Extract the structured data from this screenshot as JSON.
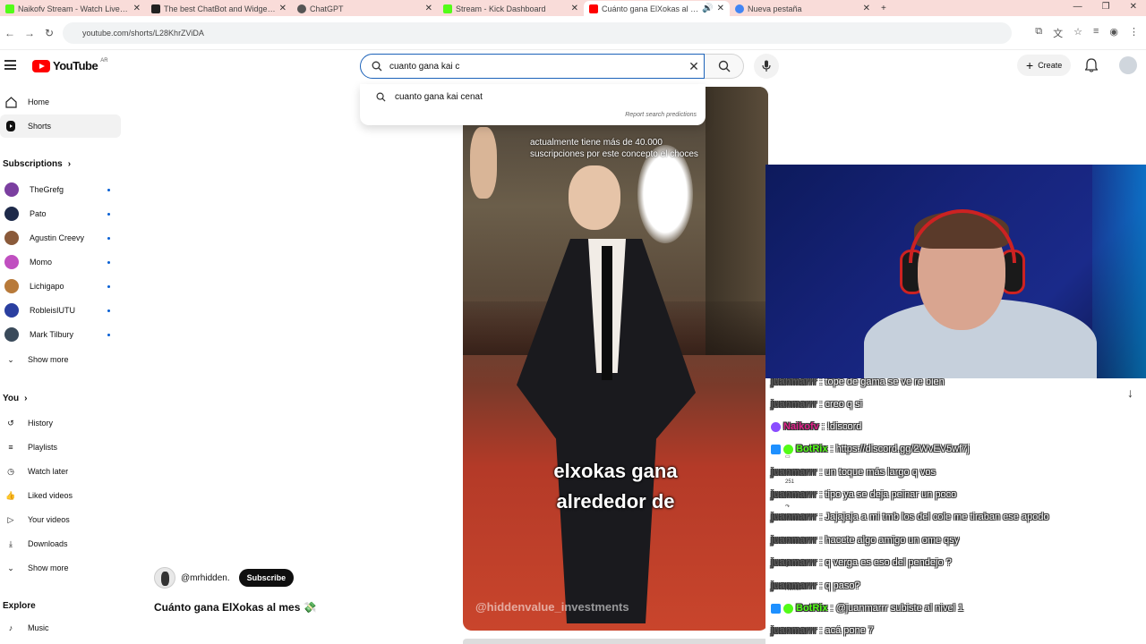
{
  "browser": {
    "tabs": [
      {
        "title": "Naikofv Stream - Watch Live on",
        "fav": "#53fc18"
      },
      {
        "title": "The best ChatBot and Widgets f",
        "fav": "#222222"
      },
      {
        "title": "ChatGPT",
        "fav": "#555555"
      },
      {
        "title": "Stream - Kick Dashboard",
        "fav": "#53fc18"
      },
      {
        "title": "Cuánto gana ElXokas al me",
        "fav": "#ff0000"
      },
      {
        "title": "Nueva pestaña",
        "fav": "#4285f4"
      }
    ],
    "url": "youtube.com/shorts/L28KhrZViDA"
  },
  "header": {
    "logo": "YouTube",
    "country": "AR",
    "search_value": "cuanto gana kai c",
    "create_label": "Create"
  },
  "suggest": {
    "item": "cuanto gana kai cenat",
    "report": "Report search predictions"
  },
  "sidebar": {
    "home": "Home",
    "shorts": "Shorts",
    "subscriptions_label": "Subscriptions",
    "channels": [
      {
        "name": "TheGrefg",
        "color": "#7b3fa0"
      },
      {
        "name": "Pato",
        "color": "#1e2a4a"
      },
      {
        "name": "Agustin Creevy",
        "color": "#8a5a3a"
      },
      {
        "name": "Momo",
        "color": "#c04fc0"
      },
      {
        "name": "Lichigapo",
        "color": "#b87a3a"
      },
      {
        "name": "RobleisIUTU",
        "color": "#2a3fa0"
      },
      {
        "name": "Mark Tilbury",
        "color": "#3a4a5a"
      }
    ],
    "show_more": "Show more",
    "you_label": "You",
    "you_items": [
      "History",
      "Playlists",
      "Watch later",
      "Liked videos",
      "Your videos",
      "Downloads",
      "Show more"
    ],
    "explore_label": "Explore",
    "explore_items": [
      "Music"
    ]
  },
  "short": {
    "caption_top": "actualmente tiene más de 40.000 suscripciones por este concepto el choces",
    "caption_line1": "elxokas gana",
    "caption_line2": "alrededor de",
    "watermark": "@hiddenvalue_investments",
    "channel": "@mrhidden.",
    "subscribe": "Subscribe",
    "title": "Cuánto gana ElXokas al mes 💸",
    "comments": "251",
    "remix": "Remix"
  },
  "chat": {
    "messages": [
      {
        "user": "juanmarrr",
        "text": ": tope de gama se ve re bien",
        "color": "#5a5a5a",
        "badges": []
      },
      {
        "user": "juanmarrr",
        "text": ": creo q si",
        "color": "#5a5a5a",
        "badges": []
      },
      {
        "user": "Naikofv",
        "text": ": !discord",
        "color": "#e0218a",
        "badges": [
          "#8a4cff"
        ]
      },
      {
        "user": "BotRix",
        "text": ": https://discord.gg/2WvEV5wf7j",
        "color": "#53fc18",
        "badges": [
          "#1e90ff",
          "#53fc18"
        ]
      },
      {
        "user": "juanmarrr",
        "text": ": un toque más largo q vos",
        "color": "#5a5a5a",
        "badges": []
      },
      {
        "user": "juanmarrr",
        "text": ": tipo ya se deja peinar un poco",
        "color": "#5a5a5a",
        "badges": []
      },
      {
        "user": "juanmarrr",
        "text": ": Jajajaja a mi tmb los del cole me tiraban ese apodo",
        "color": "#5a5a5a",
        "badges": []
      },
      {
        "user": "juanmarrr",
        "text": ": hacete algo amigo un ome qsy",
        "color": "#5a5a5a",
        "badges": []
      },
      {
        "user": "juanmarrr",
        "text": ": q verga es eso del pendejo ?",
        "color": "#5a5a5a",
        "badges": []
      },
      {
        "user": "juanmarrr",
        "text": ": q paso?",
        "color": "#5a5a5a",
        "badges": []
      },
      {
        "user": "BotRix",
        "text": ": @juanmarrr subiste al nivel 1",
        "color": "#53fc18",
        "badges": [
          "#1e90ff",
          "#53fc18"
        ]
      },
      {
        "user": "juanmarrr",
        "text": ": acá pone 7",
        "color": "#5a5a5a",
        "badges": []
      }
    ]
  }
}
